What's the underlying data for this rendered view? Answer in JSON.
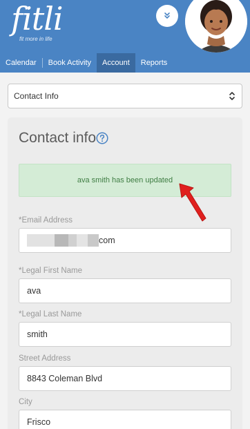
{
  "brand": {
    "logo": "fitli",
    "tagline": "fit more in life"
  },
  "nav": {
    "tabs": [
      {
        "label": "Calendar"
      },
      {
        "label": "Book Activity"
      },
      {
        "label": "Account",
        "active": true
      },
      {
        "label": "Reports"
      }
    ]
  },
  "section_select": {
    "value": "Contact Info"
  },
  "card": {
    "title": "Contact info",
    "alert": "ava smith has been updated",
    "fields": {
      "email": {
        "label": "*Email Address",
        "value_suffix": "com"
      },
      "first_name": {
        "label": "*Legal First Name",
        "value": "ava"
      },
      "last_name": {
        "label": "*Legal Last Name",
        "value": "smith"
      },
      "street": {
        "label": "Street Address",
        "value": "8843 Coleman Blvd"
      },
      "city": {
        "label": "City",
        "value": "Frisco"
      }
    }
  },
  "colors": {
    "header": "#4a84c4",
    "active_tab": "#3a6aa0",
    "alert_bg": "#d4ecd6",
    "alert_text": "#3f7d43",
    "annotation_arrow": "#e0201e"
  },
  "icons": {
    "expand": "double-chevron-down-icon",
    "select": "up-down-chevron-icon",
    "help": "question-circle-icon",
    "annotation": "red-arrow-icon"
  }
}
